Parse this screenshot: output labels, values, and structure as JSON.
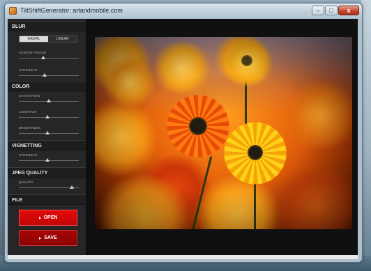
{
  "window": {
    "title": "TiltShiftGenerator: artandmobile.com",
    "buttons": {
      "minimize": "–",
      "maximize": "□",
      "close": "x"
    }
  },
  "panel": {
    "blur": {
      "header": "BLUR",
      "modes": [
        {
          "label": "RADIAL",
          "active": true
        },
        {
          "label": "LINEAR",
          "active": false
        }
      ],
      "sliders": [
        {
          "label": "CENTER RADIUS",
          "value": 0.41
        },
        {
          "label": "STRENGTH",
          "value": 0.43
        }
      ]
    },
    "color": {
      "header": "COLOR",
      "sliders": [
        {
          "label": "SATURATION",
          "value": 0.5
        },
        {
          "label": "CONTRAST",
          "value": 0.48
        },
        {
          "label": "BRIGHTNESS",
          "value": 0.48
        }
      ]
    },
    "vignetting": {
      "header": "VIGNETTING",
      "sliders": [
        {
          "label": "STRENGTH",
          "value": 0.48
        }
      ]
    },
    "jpeg": {
      "header": "JPEG QUALITY",
      "sliders": [
        {
          "label": "QUALITY",
          "value": 0.88
        }
      ]
    },
    "file": {
      "header": "FILE",
      "open_label": "OPEN",
      "save_label": "SAVE"
    }
  },
  "preview": {
    "description_colors": {
      "accent": "#e6670b",
      "open_button": "#d10808",
      "save_button": "#9a0303"
    }
  }
}
